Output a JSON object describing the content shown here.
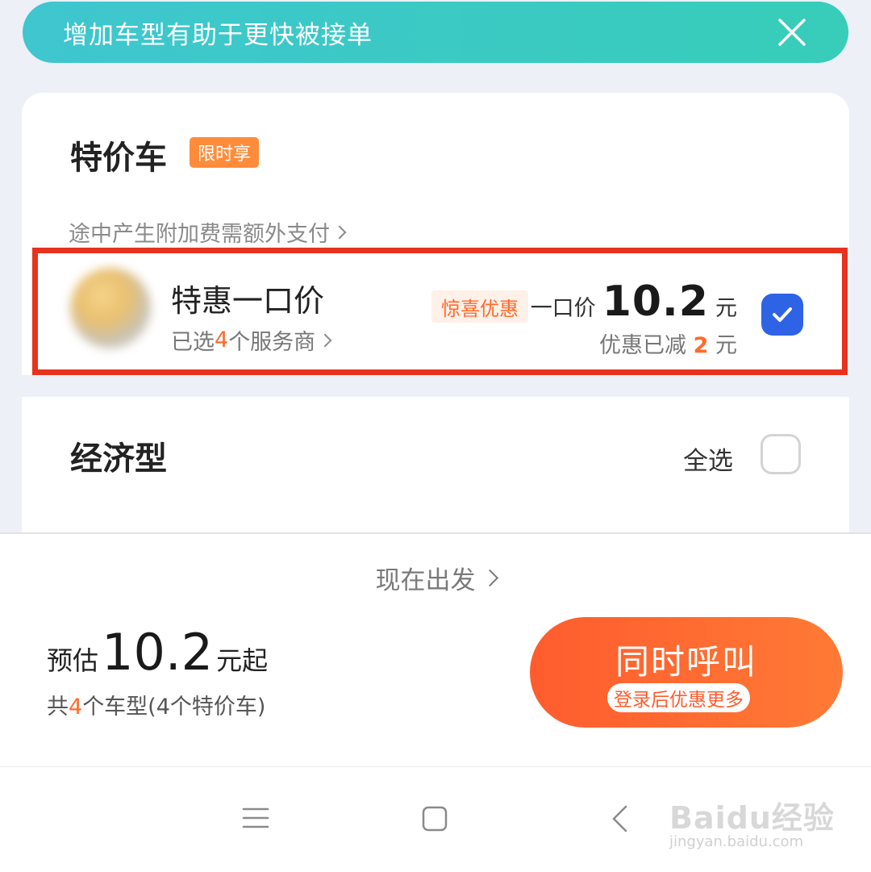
{
  "banner": {
    "text": "增加车型有助于更快被接单"
  },
  "special": {
    "title": "特价车",
    "tag": "限时享",
    "fee_note": "途中产生附加费需额外支付",
    "option": {
      "name": "特惠一口价",
      "sub_prefix": "已选",
      "sub_count": "4",
      "sub_suffix": "个服务商",
      "tag": "惊喜优惠",
      "price_label": "一口价",
      "price_value": "10.2",
      "price_unit": "元",
      "discount_prefix": "优惠已减",
      "discount_value": "2",
      "discount_unit": "元",
      "checked": true
    }
  },
  "economy": {
    "title": "经济型",
    "select_all": "全选",
    "checked": false
  },
  "bottom": {
    "depart": "现在出发",
    "est_label": "预估",
    "est_value": "10.2",
    "est_unit": "元起",
    "count_prefix": "共",
    "count_num": "4",
    "count_suffix": "个车型(4个特价车)",
    "call_label": "同时呼叫",
    "call_sub": "登录后优惠更多"
  },
  "watermark": {
    "main": "Baidu经验",
    "sub": "jingyan.baidu.com"
  },
  "colors": {
    "accent": "#ff6a2b",
    "check_blue": "#2f63e6",
    "banner_teal": "#3fc6cf",
    "highlight_red": "#e7321d"
  }
}
